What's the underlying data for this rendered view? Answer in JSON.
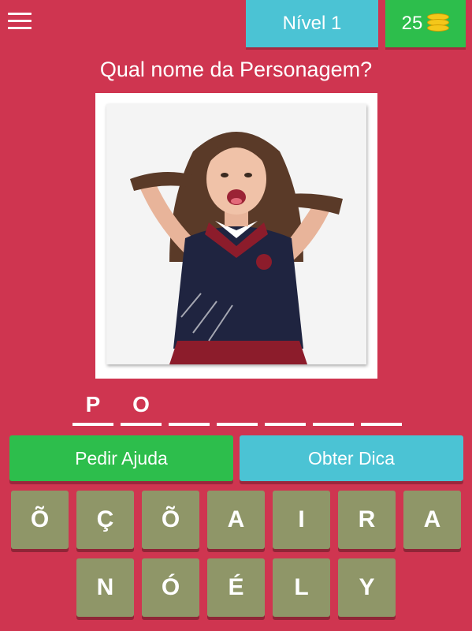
{
  "header": {
    "level_label": "Nível 1",
    "coins": "25",
    "coin_icon": "coins-stack-icon",
    "menu_icon": "hamburger-menu-icon"
  },
  "question": "Qual nome da Personagem?",
  "answer_slots": [
    "P",
    "O",
    "",
    "",
    "",
    "",
    ""
  ],
  "actions": {
    "help_label": "Pedir Ajuda",
    "hint_label": "Obter Dica"
  },
  "keyboard": {
    "row1": [
      "Õ",
      "Ç",
      "Õ",
      "A",
      "I",
      "R",
      "A"
    ],
    "row2": [
      "N",
      "Ó",
      "É",
      "L",
      "Y"
    ]
  },
  "colors": {
    "background": "#cf3550",
    "level_badge": "#4bc3d4",
    "coin_badge": "#2dbe4c",
    "help_button": "#2dbe4c",
    "hint_button": "#4bc3d4",
    "key_tile": "#8f9668"
  }
}
